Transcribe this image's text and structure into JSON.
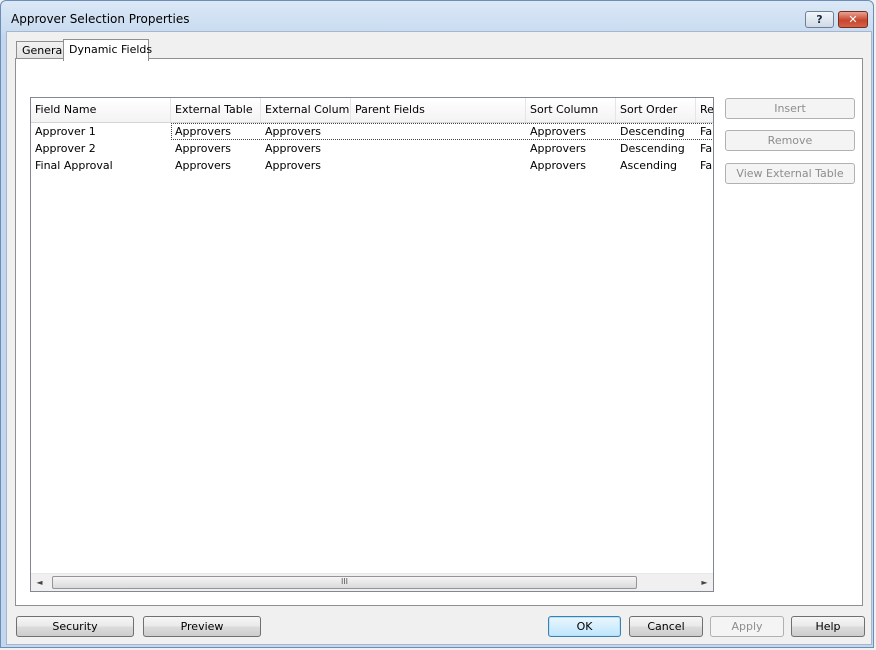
{
  "window": {
    "title": "Approver Selection Properties"
  },
  "titlebar": {
    "help_label": "?",
    "close_label": "✕"
  },
  "tabs": [
    {
      "label": "General",
      "active": false
    },
    {
      "label": "Dynamic Fields",
      "active": true
    }
  ],
  "grid": {
    "columns": [
      "Field Name",
      "External Table",
      "External Column",
      "Parent Fields",
      "Sort Column",
      "Sort Order",
      "Re"
    ],
    "rows": [
      [
        "Approver 1",
        "Approvers",
        "Approvers",
        "",
        "Approvers",
        "Descending",
        "Fa"
      ],
      [
        "Approver 2",
        "Approvers",
        "Approvers",
        "",
        "Approvers",
        "Descending",
        "Fa"
      ],
      [
        "Final Approval",
        "Approvers",
        "Approvers",
        "",
        "Approvers",
        "Ascending",
        "Fa"
      ]
    ],
    "scroll_left_icon": "◄",
    "scroll_right_icon": "►",
    "thumb_grip": "III"
  },
  "side_buttons": {
    "insert": "Insert",
    "remove": "Remove",
    "view_external_table": "View External Table"
  },
  "footer": {
    "security": "Security",
    "preview": "Preview",
    "ok": "OK",
    "cancel": "Cancel",
    "apply": "Apply",
    "help": "Help"
  }
}
